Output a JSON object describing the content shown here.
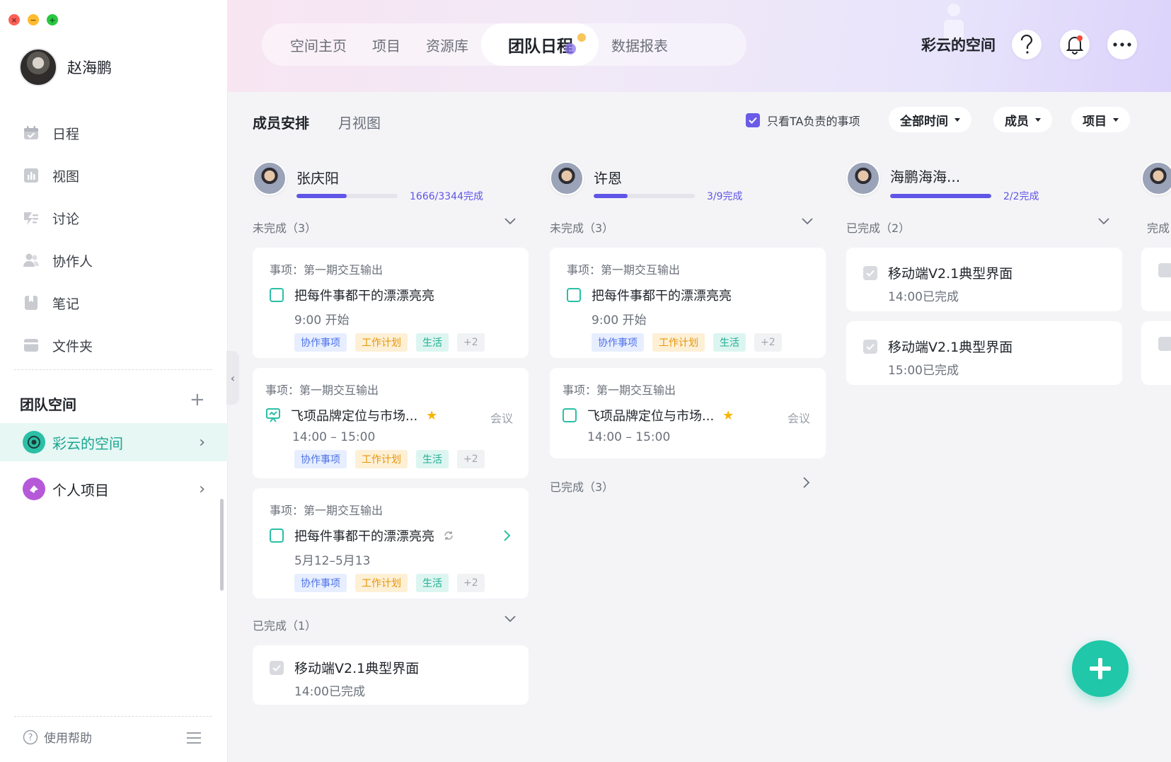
{
  "window": {
    "controls": [
      "×",
      "−",
      "+"
    ]
  },
  "user": {
    "name": "赵海鹏"
  },
  "sidebar": {
    "items": [
      {
        "label": "日程",
        "icon": "calendar-icon"
      },
      {
        "label": "视图",
        "icon": "chart-icon"
      },
      {
        "label": "讨论",
        "icon": "discussion-icon"
      },
      {
        "label": "协作人",
        "icon": "people-icon"
      },
      {
        "label": "笔记",
        "icon": "note-icon"
      },
      {
        "label": "文件夹",
        "icon": "folder-icon"
      }
    ],
    "section_title": "团队空间",
    "add_label": "+",
    "spaces": [
      {
        "label": "彩云的空间",
        "active": true
      },
      {
        "label": "个人项目",
        "active": false
      }
    ],
    "collapse": "‹",
    "help_label": "使用帮助"
  },
  "header": {
    "tabs": [
      "空间主页",
      "项目",
      "资源库",
      "团队日程",
      "数据报表"
    ],
    "active_tab": "团队日程",
    "space_title": "彩云的空间",
    "help_icon": "question-icon",
    "bell_icon": "bell-icon",
    "more_icon": "more-icon"
  },
  "toolbar": {
    "tab_members": "成员安排",
    "tab_month": "月视图",
    "filter_label": "只看TA负责的事项",
    "filter_checked": true,
    "dropdown_time": "全部时间",
    "dropdown_member": "成员",
    "dropdown_project": "项目"
  },
  "columns": [
    {
      "name": "张庆阳",
      "progress_text": "1666/3344完成",
      "progress": 0.498,
      "group1": "未完成（3）",
      "cards": [
        {
          "pre": "事项：第一期交互输出",
          "title": "把每件事都干的漂漂亮亮",
          "time": "9:00 开始",
          "tags": [
            "协作事项",
            "工作计划",
            "生活",
            "+2"
          ]
        },
        {
          "pre": "事项：第一期交互输出",
          "title": "飞项品牌定位与市场...",
          "meeting": "会议",
          "time": "14:00 – 15:00",
          "tags": [
            "协作事项",
            "工作计划",
            "生活",
            "+2"
          ]
        },
        {
          "pre": "事项：第一期交互输出",
          "title": "把每件事都干的漂漂亮亮",
          "time": "5月12–5月13",
          "tags": [
            "协作事项",
            "工作计划",
            "生活",
            "+2"
          ]
        }
      ],
      "group2": "已完成（1）",
      "done": [
        {
          "title": "移动端V2.1典型界面",
          "time": "14:00已完成"
        }
      ]
    },
    {
      "name": "许恩",
      "progress_text": "3/9完成",
      "progress": 0.333,
      "group1": "未完成（3）",
      "cards": [
        {
          "pre": "事项：第一期交互输出",
          "title": "把每件事都干的漂漂亮亮",
          "time": "9:00 开始",
          "tags": [
            "协作事项",
            "工作计划",
            "生活",
            "+2"
          ]
        },
        {
          "pre": "事项：第一期交互输出",
          "title": "飞项品牌定位与市场...",
          "meeting": "会议",
          "time": "14:00 – 15:00"
        }
      ],
      "group2": "已完成（3）"
    },
    {
      "name": "海鹏海海...",
      "progress_text": "2/2完成",
      "progress": 1.0,
      "group1": "已完成（2）",
      "done": [
        {
          "title": "移动端V2.1典型界面",
          "time": "14:00已完成"
        },
        {
          "title": "移动端V2.1典型界面",
          "time": "15:00已完成"
        }
      ]
    },
    {
      "group1": "完成"
    }
  ],
  "fab_label": "+",
  "colors": {
    "accent": "#5f55e6",
    "teal": "#20c7a8",
    "active_bg": "#e6f7f4"
  }
}
